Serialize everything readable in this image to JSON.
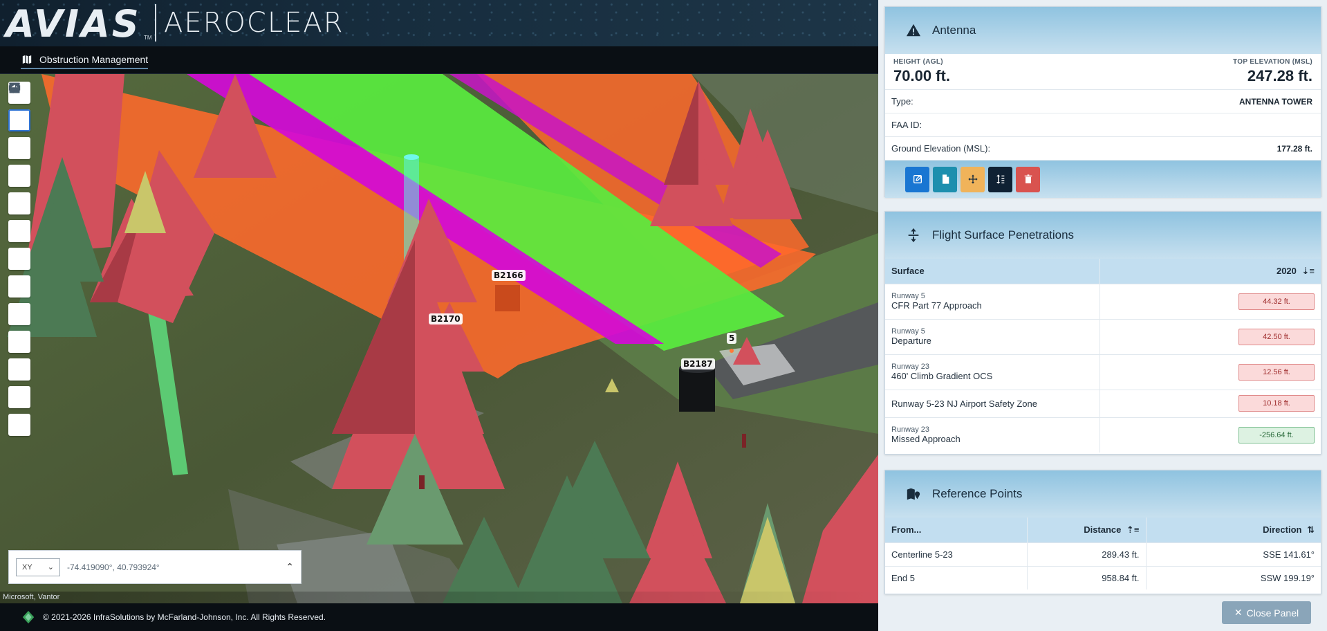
{
  "header": {
    "logo_primary": "AVIAS",
    "logo_tm": "TM",
    "logo_secondary": "AEROCLEAR"
  },
  "nav": {
    "active_label": "Obstruction Management"
  },
  "map": {
    "labels": [
      "B2166",
      "B2170",
      "B2187",
      "5"
    ],
    "toolbar_icons": [
      "home-icon",
      "layers-icon",
      "list-icon",
      "filter-icon",
      "search-map-icon",
      "history-icon",
      "add-point-icon",
      "qr-grid-icon",
      "measure-icon",
      "report-icon",
      "fullscreen-icon",
      "terrain-icon",
      "globe-icon"
    ],
    "coord_mode": "XY",
    "coords": "-74.419090°, 40.793924°",
    "attribution": "Microsoft, Vantor"
  },
  "footer": {
    "copyright": "© 2021-2026 InfraSolutions by McFarland-Johnson, Inc. All Rights Reserved."
  },
  "antenna": {
    "title": "Antenna",
    "height_label": "HEIGHT (AGL)",
    "height_value": "70.00 ft.",
    "top_label": "TOP ELEVATION (MSL)",
    "top_value": "247.28 ft.",
    "rows": [
      {
        "label": "Type:",
        "value": "ANTENNA TOWER"
      },
      {
        "label": "FAA ID:",
        "value": ""
      },
      {
        "label": "Ground Elevation (MSL):",
        "value": "177.28 ft."
      }
    ],
    "actions": [
      {
        "name": "edit-button",
        "icon": "edit-icon",
        "color": "#1976d2"
      },
      {
        "name": "document-button",
        "icon": "document-icon",
        "color": "#1d8fae"
      },
      {
        "name": "move-button",
        "icon": "move-icon",
        "color": "#f0b35a"
      },
      {
        "name": "height-button",
        "icon": "height-icon",
        "color": "#0f2133"
      },
      {
        "name": "delete-button",
        "icon": "trash-icon",
        "color": "#d9534f"
      }
    ]
  },
  "penetrations": {
    "title": "Flight Surface Penetrations",
    "col_surface": "Surface",
    "col_year": "2020",
    "rows": [
      {
        "runway": "Runway 5",
        "surface": "CFR Part 77 Approach",
        "value": "44.32 ft.",
        "status": "red"
      },
      {
        "runway": "Runway 5",
        "surface": "Departure",
        "value": "42.50 ft.",
        "status": "red"
      },
      {
        "runway": "Runway 23",
        "surface": "460' Climb Gradient OCS",
        "value": "12.56 ft.",
        "status": "red"
      },
      {
        "runway": "",
        "surface": "Runway 5-23 NJ Airport Safety Zone",
        "value": "10.18 ft.",
        "status": "red"
      },
      {
        "runway": "Runway 23",
        "surface": "Missed Approach",
        "value": "-256.64 ft.",
        "status": "green"
      }
    ]
  },
  "refpoints": {
    "title": "Reference Points",
    "col_from": "From...",
    "col_distance": "Distance",
    "col_direction": "Direction",
    "rows": [
      {
        "from": "Centerline 5-23",
        "distance": "289.43 ft.",
        "direction": "SSE 141.61°"
      },
      {
        "from": "End 5",
        "distance": "958.84 ft.",
        "direction": "SSW 199.19°"
      }
    ]
  },
  "close_label": "Close Panel"
}
